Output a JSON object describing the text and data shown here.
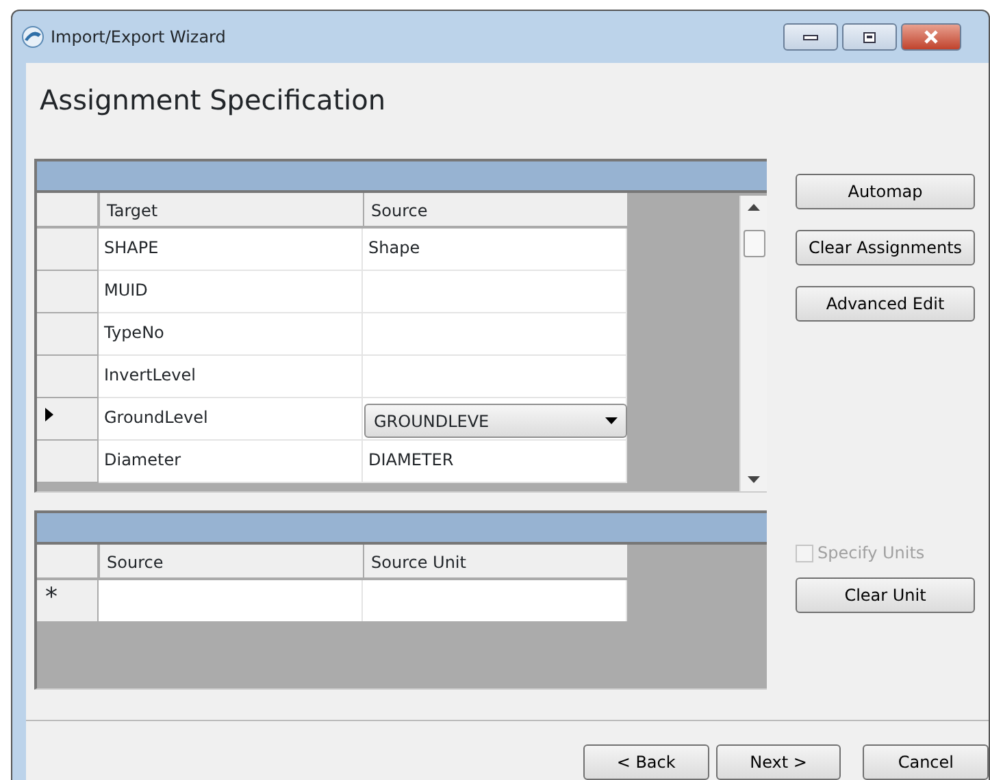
{
  "window": {
    "title": "Import/Export Wizard"
  },
  "heading": "Assignment Specification",
  "assignment_grid": {
    "columns": [
      "Target",
      "Source"
    ],
    "rows": [
      {
        "target": "SHAPE",
        "source": "Shape",
        "kind": "text",
        "selected": false
      },
      {
        "target": "MUID",
        "source": "",
        "kind": "text",
        "selected": false
      },
      {
        "target": "TypeNo",
        "source": "",
        "kind": "text",
        "selected": false
      },
      {
        "target": "InvertLevel",
        "source": "",
        "kind": "text",
        "selected": false
      },
      {
        "target": "GroundLevel",
        "source": "GROUNDLEVE",
        "kind": "dropdown",
        "selected": true
      },
      {
        "target": "Diameter",
        "source": "DIAMETER",
        "kind": "text",
        "selected": false
      }
    ]
  },
  "side_buttons": [
    "Automap",
    "Clear Assignments",
    "Advanced Edit"
  ],
  "unit_grid": {
    "columns": [
      "Source",
      "Source Unit"
    ],
    "new_row_marker": "*"
  },
  "specify_units": {
    "label": "Specify Units",
    "checked": false,
    "disabled": true
  },
  "clear_unit_button": "Clear Unit",
  "footer_buttons": [
    "< Back",
    "Next >",
    "Cancel"
  ]
}
